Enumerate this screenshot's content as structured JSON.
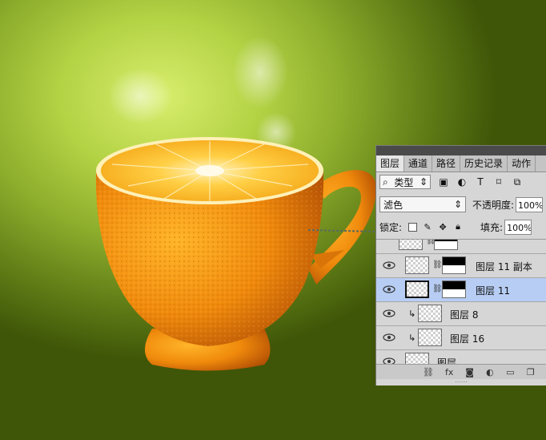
{
  "panel": {
    "tabs": [
      {
        "label": "图层",
        "active": true
      },
      {
        "label": "通道",
        "active": false
      },
      {
        "label": "路径",
        "active": false
      },
      {
        "label": "历史记录",
        "active": false
      },
      {
        "label": "动作",
        "active": false
      }
    ],
    "filter": {
      "label": "类型",
      "icon": "search-icon"
    },
    "filter_icons": [
      "image-filter-icon",
      "adjustment-filter-icon",
      "text-filter-icon",
      "shape-filter-icon",
      "smart-object-filter-icon"
    ],
    "blend_mode": "滤色",
    "opacity_label": "不透明度:",
    "opacity_value": "100%",
    "lock_label": "锁定:",
    "lock_icons": [
      "lock-transparent-icon",
      "lock-paint-icon",
      "lock-move-icon",
      "lock-all-icon"
    ],
    "fill_label": "填充:",
    "fill_value": "100%",
    "layers": [
      {
        "name": "图层 11 副本",
        "visible": true,
        "selected": false,
        "has_mask": true,
        "clipped": false
      },
      {
        "name": "图层 11",
        "visible": true,
        "selected": true,
        "has_mask": true,
        "clipped": false
      },
      {
        "name": "图层 8",
        "visible": true,
        "selected": false,
        "has_mask": false,
        "clipped": true
      },
      {
        "name": "图层 16",
        "visible": true,
        "selected": false,
        "has_mask": false,
        "clipped": true
      },
      {
        "name": "图层",
        "visible": true,
        "selected": false,
        "has_mask": false,
        "clipped": false
      }
    ],
    "bottom_icons": [
      "link-icon",
      "fx-icon",
      "add-mask-icon",
      "adjustment-layer-icon",
      "new-group-icon",
      "new-layer-icon"
    ],
    "fx_label": "fx"
  },
  "colors": {
    "background_light": "#d8ee6e",
    "background_dark": "#3f5608",
    "orange": "#f29a12",
    "selection": "#b7cdf3"
  }
}
